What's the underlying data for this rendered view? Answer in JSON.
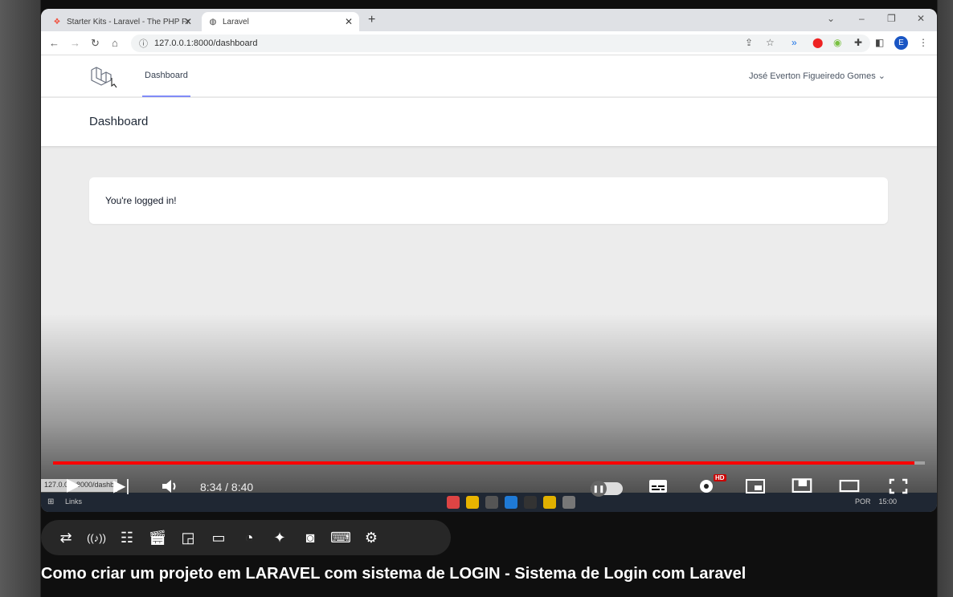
{
  "browser": {
    "tabs": [
      {
        "label": "Starter Kits - Laravel - The PHP Fr",
        "active": false
      },
      {
        "label": "Laravel",
        "active": true
      }
    ],
    "url": "127.0.0.1:8000/dashboard",
    "profile_initial": "E",
    "status_url": "127.0.0.1:8000/dashb"
  },
  "app": {
    "nav_link": "Dashboard",
    "user_name": "José Everton Figueiredo Gomes",
    "header_title": "Dashboard",
    "card_text": "You're logged in!"
  },
  "taskbar": {
    "links_label": "Links",
    "language": "POR",
    "clock": "15:00"
  },
  "player": {
    "time": "8:34 / 8:40",
    "progress": 0.988,
    "hd_badge": "HD",
    "accent_color": "#ff0000"
  },
  "video": {
    "title": "Como criar um projeto em LARAVEL com sistema de LOGIN - Sistema de Login com Laravel"
  }
}
